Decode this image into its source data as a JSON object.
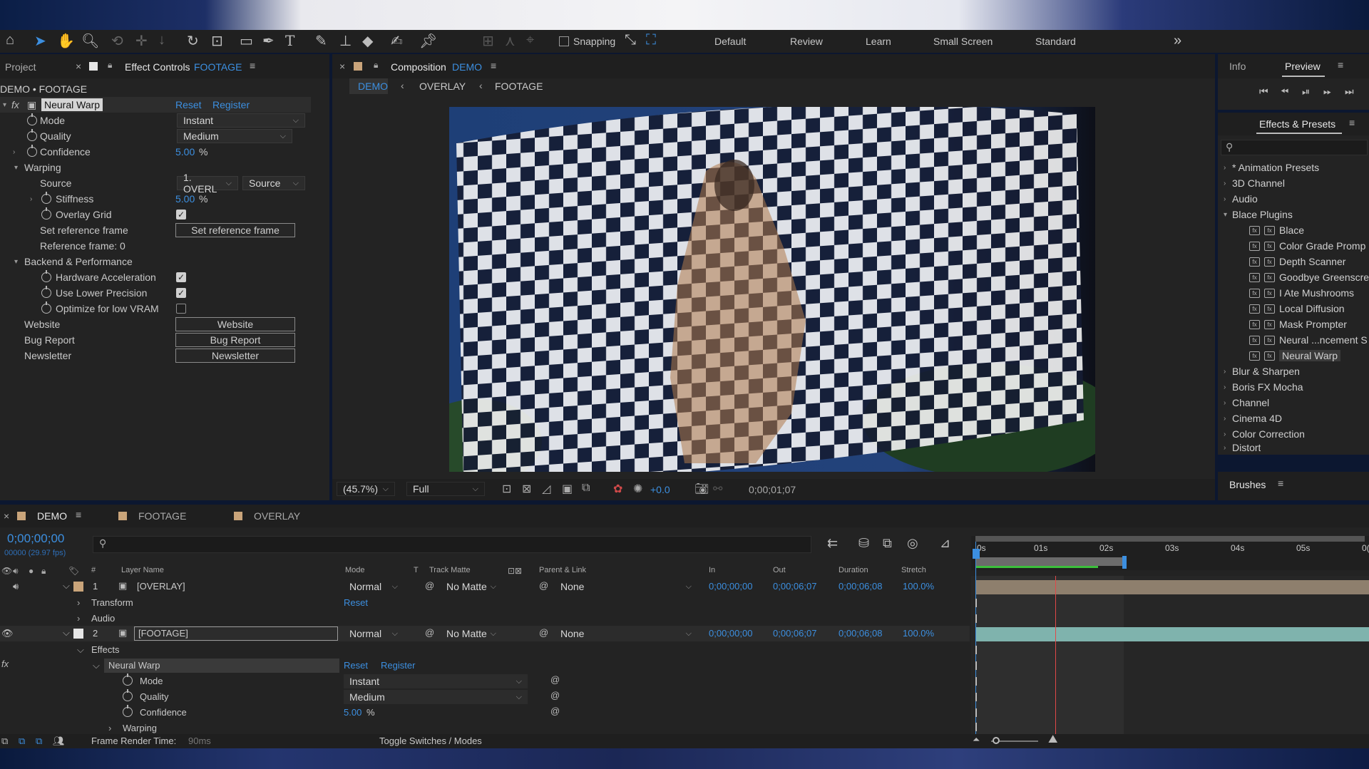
{
  "toolbar": {
    "snapping_label": "Snapping",
    "workspaces": [
      "Default",
      "Review",
      "Learn",
      "Small Screen",
      "Standard"
    ],
    "overflow_label": "»"
  },
  "left_panel": {
    "project_tab": "Project",
    "effect_controls_tab": "Effect Controls",
    "effect_controls_target": "FOOTAGE",
    "breadcrumb": "DEMO • FOOTAGE",
    "effect_name": "Neural Warp",
    "reset": "Reset",
    "register": "Register",
    "mode_label": "Mode",
    "mode_value": "Instant",
    "quality_label": "Quality",
    "quality_value": "Medium",
    "confidence_label": "Confidence",
    "confidence_value": "5.00",
    "confidence_unit": "%",
    "warping_label": "Warping",
    "source_label": "Source",
    "source_layer": "1. OVERL",
    "source_value": "Source",
    "stiffness_label": "Stiffness",
    "stiffness_value": "5.00",
    "stiffness_unit": "%",
    "overlay_grid_label": "Overlay Grid",
    "overlay_grid": true,
    "set_ref_label": "Set reference frame",
    "set_ref_button": "Set reference frame",
    "ref_frame_text": "Reference frame: 0",
    "backend_label": "Backend & Performance",
    "hw_accel_label": "Hardware Acceleration",
    "hw_accel": true,
    "lower_precision_label": "Use Lower Precision",
    "lower_precision": true,
    "low_vram_label": "Optimize for low VRAM",
    "low_vram": false,
    "website_label": "Website",
    "website_button": "Website",
    "bug_report_label": "Bug Report",
    "bug_report_button": "Bug Report",
    "newsletter_label": "Newsletter",
    "newsletter_button": "Newsletter"
  },
  "composition": {
    "tab_prefix": "Composition",
    "tab_name": "DEMO",
    "breadcrumbs": [
      "DEMO",
      "OVERLAY",
      "FOOTAGE"
    ],
    "zoom": "(45.7%)",
    "resolution": "Full",
    "exposure": "+0.0",
    "timecode": "0;00;01;07"
  },
  "right_panel": {
    "info_tab": "Info",
    "preview_tab": "Preview",
    "effects_tab": "Effects & Presets",
    "categories_top": [
      "* Animation Presets",
      "3D Channel",
      "Audio",
      "Blace Plugins"
    ],
    "plugins": [
      "Blace",
      "Color Grade Promp",
      "Depth Scanner",
      "Goodbye Greenscre",
      "I Ate Mushrooms",
      "Local Diffusion",
      "Mask Prompter",
      "Neural ...ncement S",
      "Neural Warp"
    ],
    "categories_bottom": [
      "Blur & Sharpen",
      "Boris FX Mocha",
      "Channel",
      "Cinema 4D",
      "Color Correction",
      "Distort"
    ],
    "brushes_tab": "Brushes"
  },
  "timeline": {
    "tabs": [
      "DEMO",
      "FOOTAGE",
      "OVERLAY"
    ],
    "timecode": "0;00;00;00",
    "frame_info": "00000 (29.97 fps)",
    "columns": {
      "number": "#",
      "layer_name": "Layer Name",
      "mode": "Mode",
      "t": "T",
      "track_matte": "Track Matte",
      "parent": "Parent & Link",
      "in": "In",
      "out": "Out",
      "duration": "Duration",
      "stretch": "Stretch"
    },
    "ruler": [
      "0s",
      "01s",
      "02s",
      "03s",
      "04s",
      "05s",
      "0("
    ],
    "layers": [
      {
        "num": "1",
        "name": "[OVERLAY]",
        "mode": "Normal",
        "matte": "No Matte",
        "parent": "None",
        "in": "0;00;00;00",
        "out": "0;00;06;07",
        "duration": "0;00;06;08",
        "stretch": "100.0%"
      },
      {
        "num": "2",
        "name": "[FOOTAGE]",
        "mode": "Normal",
        "matte": "No Matte",
        "parent": "None",
        "in": "0;00;00;00",
        "out": "0;00;06;07",
        "duration": "0;00;06;08",
        "stretch": "100.0%"
      }
    ],
    "transform_label": "Transform",
    "transform_reset": "Reset",
    "audio_label": "Audio",
    "effects_label": "Effects",
    "fx_label": "fx",
    "effect_name": "Neural Warp",
    "effect_reset": "Reset",
    "effect_register": "Register",
    "mode_label": "Mode",
    "mode_value": "Instant",
    "quality_label": "Quality",
    "quality_value": "Medium",
    "confidence_label": "Confidence",
    "confidence_value": "5.00",
    "confidence_unit": "%",
    "warping_label": "Warping",
    "render_time_label": "Frame Render Time:",
    "render_time_value": "90ms",
    "toggle_label": "Toggle Switches / Modes"
  },
  "colors": {
    "accent_blue": "#3c8fe0",
    "panel_bg": "#232323",
    "layer_overlay_bar": "#8e7f6d",
    "layer_footage_bar": "#7fb3ad"
  }
}
